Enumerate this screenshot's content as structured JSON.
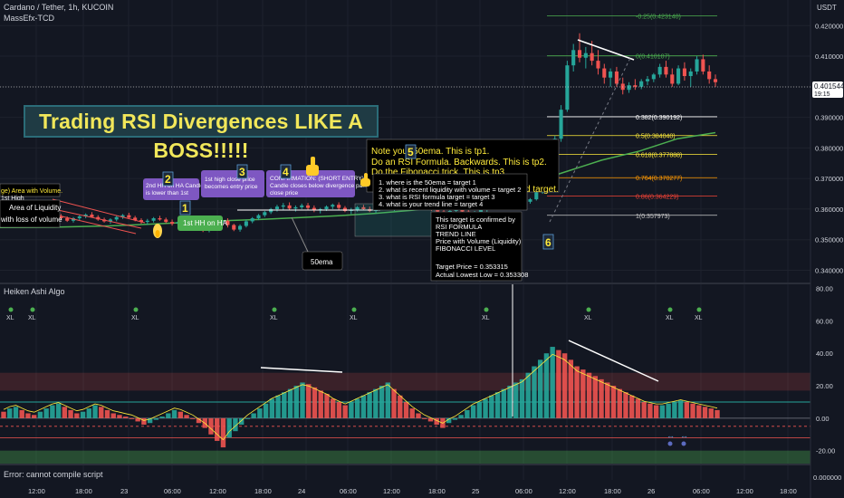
{
  "header": {
    "symbol_line": "Cardano / Tether, 1h, KUCOIN",
    "indicator_line": "MassEfx-TCD"
  },
  "banner": "Trading RSI Divergences LIKE A BOSS!!!!!",
  "lower_pane": {
    "title": "Heiken Ashi Algo",
    "error": "Error: cannot compile script",
    "xl_marks": [
      "XL",
      "XL",
      "XL",
      "XL",
      "XL",
      "XL",
      "XL",
      "XL",
      "XL"
    ],
    "arrow_marks": [
      "↔",
      "↔"
    ]
  },
  "price_axis": {
    "label": "USDT",
    "ticks": [
      "0.420000",
      "0.410000",
      "0.400000",
      "0.390000",
      "0.380000",
      "0.370000",
      "0.360000",
      "0.350000",
      "0.340000"
    ],
    "current_price": "0.401544",
    "countdown": "19:15"
  },
  "osc_axis": {
    "ticks": [
      "80.00",
      "60.00",
      "40.00",
      "20.00",
      "0.00",
      "-20.00"
    ],
    "bottom_tick": "0.000000"
  },
  "time_axis": [
    "12:00",
    "18:00",
    "23",
    "06:00",
    "12:00",
    "18:00",
    "24",
    "06:00",
    "12:00",
    "18:00",
    "25",
    "06:00",
    "12:00",
    "18:00",
    "26",
    "06:00",
    "12:00",
    "18:00"
  ],
  "fib_levels": [
    {
      "label": "-0.25(0.423140)",
      "color": "#4caf50"
    },
    {
      "label": "0(0.410107)",
      "color": "#4caf50"
    },
    {
      "label": "0.382(0.390192)",
      "color": "#ffffff"
    },
    {
      "label": "0.5(0.384040)",
      "color": "#ffeb3b"
    },
    {
      "label": "0.618(0.377888)",
      "color": "#ffeb3b"
    },
    {
      "label": "0.764(0.370277)",
      "color": "#ff9800"
    },
    {
      "label": "0.86(0.364229)",
      "color": "#f44336"
    },
    {
      "label": "1(0.357973)",
      "color": "#cccccc"
    }
  ],
  "step_labels": [
    "1",
    "2",
    "3",
    "4",
    "5",
    "6"
  ],
  "annotations": {
    "left_1": "ge) Area with Volume.",
    "left_1b": "1st High",
    "left_2": "Area of Liquidity",
    "left_3": "with loss of volume",
    "hh_label": "1st HH on HA",
    "note_2": [
      "2nd HH on HA Candle",
      "is lower than 1st"
    ],
    "note_3": [
      "1st high close price",
      "becomes entry price"
    ],
    "note_4": [
      "CONFIRMATION: (SHORT ENTRY)",
      "Candle closes below divergence pa...",
      "close price"
    ],
    "ema_label": "50ema",
    "yellow_note": [
      "Note your 50ema. This is tp1.",
      "Do an RSI Formula. Backwards. This is tp2.",
      "Do the Fibonacci trick. This is tp3",
      "",
      "d target."
    ],
    "target_list": [
      "1. where is the 50ema  = target 1",
      "2. what is recent liquidity with volume = target 2",
      "3. what is RSI formula target = target 3",
      "4. what is your trend line = target 4"
    ],
    "confirm_box": [
      "This target is confirmed by",
      "RSI FORMULA",
      "TREND LINE",
      "Price with Volume (Liquidity)",
      "FIBONACCI LEVEL",
      "",
      "Target Price = 0.353315",
      "Actual Lowest Low = 0.353308"
    ]
  },
  "colors": {
    "bg": "#131722",
    "bull": "#26a69a",
    "bear": "#ef5350",
    "ema": "#4caf50",
    "banner_text": "#f1e75a",
    "accent_purple": "#7e57c2"
  },
  "chart_data": {
    "type": "candlestick",
    "symbol": "Cardano / Tether, 1h, KUCOIN",
    "ylim": [
      0.336,
      0.426
    ],
    "ohlc": [
      [
        0.3575,
        0.3582,
        0.3565,
        0.357
      ],
      [
        0.357,
        0.3578,
        0.356,
        0.3574
      ],
      [
        0.3574,
        0.3585,
        0.3568,
        0.358
      ],
      [
        0.358,
        0.3586,
        0.357,
        0.3572
      ],
      [
        0.3572,
        0.3579,
        0.3562,
        0.3566
      ],
      [
        0.3566,
        0.3576,
        0.356,
        0.3572
      ],
      [
        0.3572,
        0.3584,
        0.3568,
        0.358
      ],
      [
        0.358,
        0.359,
        0.3574,
        0.3586
      ],
      [
        0.3586,
        0.3592,
        0.3576,
        0.3578
      ],
      [
        0.3578,
        0.3584,
        0.3566,
        0.357
      ],
      [
        0.357,
        0.3576,
        0.3558,
        0.3562
      ],
      [
        0.3562,
        0.3574,
        0.3556,
        0.357
      ],
      [
        0.357,
        0.358,
        0.3564,
        0.3576
      ],
      [
        0.3576,
        0.3586,
        0.357,
        0.3582
      ],
      [
        0.3582,
        0.359,
        0.3572,
        0.3574
      ],
      [
        0.3574,
        0.358,
        0.3562,
        0.3566
      ],
      [
        0.3566,
        0.3572,
        0.3556,
        0.356
      ],
      [
        0.356,
        0.357,
        0.3552,
        0.3566
      ],
      [
        0.3566,
        0.3578,
        0.356,
        0.3574
      ],
      [
        0.3574,
        0.3584,
        0.3568,
        0.358
      ],
      [
        0.358,
        0.3588,
        0.357,
        0.3572
      ],
      [
        0.3572,
        0.3578,
        0.356,
        0.3564
      ],
      [
        0.3564,
        0.357,
        0.3552,
        0.3558
      ],
      [
        0.3558,
        0.3568,
        0.3548,
        0.3562
      ],
      [
        0.3562,
        0.3574,
        0.3556,
        0.357
      ],
      [
        0.357,
        0.3578,
        0.3562,
        0.3566
      ],
      [
        0.3566,
        0.3572,
        0.3554,
        0.3558
      ],
      [
        0.3558,
        0.3566,
        0.3546,
        0.3552
      ],
      [
        0.3552,
        0.3562,
        0.3544,
        0.3558
      ],
      [
        0.3558,
        0.3568,
        0.355,
        0.3564
      ],
      [
        0.3564,
        0.357,
        0.3552,
        0.3556
      ],
      [
        0.3556,
        0.3562,
        0.354,
        0.3545
      ],
      [
        0.3545,
        0.355,
        0.3525,
        0.353
      ],
      [
        0.353,
        0.3548,
        0.3524,
        0.3544
      ],
      [
        0.3544,
        0.356,
        0.3538,
        0.3556
      ],
      [
        0.3556,
        0.3566,
        0.3548,
        0.3562
      ],
      [
        0.3562,
        0.357,
        0.354,
        0.3548
      ],
      [
        0.3548,
        0.3552,
        0.3528,
        0.3533
      ],
      [
        0.3533,
        0.355,
        0.3526,
        0.3545
      ],
      [
        0.3545,
        0.3566,
        0.354,
        0.356
      ],
      [
        0.356,
        0.3574,
        0.3554,
        0.357
      ],
      [
        0.357,
        0.3584,
        0.3564,
        0.358
      ],
      [
        0.358,
        0.3594,
        0.3574,
        0.359
      ],
      [
        0.359,
        0.3604,
        0.3584,
        0.36
      ],
      [
        0.36,
        0.3614,
        0.3592,
        0.3608
      ],
      [
        0.3608,
        0.362,
        0.3598,
        0.3612
      ],
      [
        0.3612,
        0.3622,
        0.3596,
        0.3602
      ],
      [
        0.3602,
        0.3612,
        0.3592,
        0.3606
      ],
      [
        0.3606,
        0.3618,
        0.36,
        0.3612
      ],
      [
        0.3612,
        0.362,
        0.3598,
        0.3604
      ],
      [
        0.3604,
        0.3612,
        0.359,
        0.3596
      ],
      [
        0.3596,
        0.3604,
        0.3586,
        0.36
      ],
      [
        0.36,
        0.3612,
        0.3594,
        0.3608
      ],
      [
        0.3608,
        0.3618,
        0.36,
        0.3614
      ],
      [
        0.3614,
        0.3622,
        0.3598,
        0.3604
      ],
      [
        0.3604,
        0.361,
        0.359,
        0.3594
      ],
      [
        0.3594,
        0.3604,
        0.3584,
        0.3598
      ],
      [
        0.3598,
        0.361,
        0.3592,
        0.3606
      ],
      [
        0.3606,
        0.3614,
        0.3596,
        0.36
      ],
      [
        0.36,
        0.3608,
        0.359,
        0.3594
      ],
      [
        0.3594,
        0.3606,
        0.3588,
        0.3602
      ],
      [
        0.3602,
        0.3612,
        0.3596,
        0.3608
      ],
      [
        0.3608,
        0.3616,
        0.3598,
        0.3602
      ],
      [
        0.3602,
        0.361,
        0.3594,
        0.3606
      ],
      [
        0.3606,
        0.3618,
        0.36,
        0.3614
      ],
      [
        0.3614,
        0.3624,
        0.3606,
        0.3618
      ],
      [
        0.3618,
        0.3628,
        0.361,
        0.3622
      ],
      [
        0.3622,
        0.363,
        0.3608,
        0.3612
      ],
      [
        0.3612,
        0.3618,
        0.36,
        0.3606
      ],
      [
        0.3606,
        0.3612,
        0.3594,
        0.36
      ],
      [
        0.36,
        0.3608,
        0.3586,
        0.3592
      ],
      [
        0.3592,
        0.36,
        0.358,
        0.3588
      ],
      [
        0.3588,
        0.3598,
        0.3578,
        0.3594
      ],
      [
        0.3594,
        0.3604,
        0.3586,
        0.3598
      ],
      [
        0.3598,
        0.3606,
        0.3588,
        0.3592
      ],
      [
        0.3592,
        0.3598,
        0.358,
        0.3586
      ],
      [
        0.3586,
        0.3594,
        0.3576,
        0.359
      ],
      [
        0.359,
        0.3602,
        0.3584,
        0.3598
      ],
      [
        0.3598,
        0.361,
        0.359,
        0.3606
      ],
      [
        0.3606,
        0.3618,
        0.3598,
        0.3614
      ],
      [
        0.3614,
        0.3626,
        0.3606,
        0.3622
      ],
      [
        0.3622,
        0.3634,
        0.3614,
        0.363
      ],
      [
        0.363,
        0.364,
        0.362,
        0.3626
      ],
      [
        0.3626,
        0.3632,
        0.3614,
        0.3618
      ],
      [
        0.3618,
        0.3628,
        0.361,
        0.3624
      ],
      [
        0.3624,
        0.3636,
        0.3618,
        0.3632
      ],
      [
        0.3632,
        0.366,
        0.3628,
        0.3655
      ],
      [
        0.3655,
        0.37,
        0.365,
        0.3695
      ],
      [
        0.3695,
        0.374,
        0.369,
        0.373
      ],
      [
        0.373,
        0.384,
        0.3725,
        0.383
      ],
      [
        0.383,
        0.394,
        0.382,
        0.3925
      ],
      [
        0.3925,
        0.4085,
        0.3918,
        0.407
      ],
      [
        0.407,
        0.414,
        0.405,
        0.412
      ],
      [
        0.412,
        0.4175,
        0.408,
        0.4095
      ],
      [
        0.4095,
        0.413,
        0.406,
        0.411
      ],
      [
        0.411,
        0.415,
        0.407,
        0.4085
      ],
      [
        0.4085,
        0.412,
        0.404,
        0.406
      ],
      [
        0.406,
        0.4075,
        0.401,
        0.403
      ],
      [
        0.403,
        0.406,
        0.4,
        0.405
      ],
      [
        0.405,
        0.4065,
        0.4,
        0.401
      ],
      [
        0.401,
        0.403,
        0.3975,
        0.399
      ],
      [
        0.399,
        0.4015,
        0.398,
        0.4005
      ],
      [
        0.4005,
        0.4025,
        0.399,
        0.4
      ],
      [
        0.4,
        0.4025,
        0.3992,
        0.4018
      ],
      [
        0.4018,
        0.4035,
        0.4005,
        0.4025
      ],
      [
        0.4025,
        0.4045,
        0.4015,
        0.404
      ],
      [
        0.404,
        0.4075,
        0.403,
        0.4065
      ],
      [
        0.4065,
        0.4085,
        0.403,
        0.404
      ],
      [
        0.404,
        0.406,
        0.4,
        0.401
      ],
      [
        0.401,
        0.407,
        0.4005,
        0.406
      ],
      [
        0.406,
        0.408,
        0.402,
        0.4035
      ],
      [
        0.4035,
        0.406,
        0.4,
        0.405
      ],
      [
        0.405,
        0.41,
        0.404,
        0.409
      ],
      [
        0.409,
        0.4105,
        0.404,
        0.405
      ],
      [
        0.405,
        0.407,
        0.401,
        0.4025
      ],
      [
        0.4025,
        0.404,
        0.4,
        0.4015
      ]
    ],
    "ema50": [
      0.3545,
      0.355,
      0.3556,
      0.3562,
      0.3566,
      0.3572,
      0.3578,
      0.3586,
      0.3596,
      0.3612,
      0.364,
      0.368,
      0.372,
      0.376,
      0.379,
      0.383,
      0.385
    ],
    "osc_ylim": [
      -28,
      82
    ],
    "osc_hist": [
      4,
      6,
      7,
      5,
      3,
      2,
      4,
      6,
      8,
      9,
      7,
      5,
      3,
      4,
      6,
      8,
      7,
      5,
      3,
      2,
      1,
      0,
      -2,
      -4,
      -3,
      -1,
      1,
      3,
      5,
      4,
      2,
      0,
      -3,
      -6,
      -10,
      -14,
      -18,
      -12,
      -8,
      -4,
      0,
      3,
      6,
      9,
      12,
      14,
      16,
      18,
      20,
      22,
      21,
      19,
      17,
      15,
      12,
      10,
      8,
      10,
      12,
      14,
      16,
      18,
      20,
      22,
      18,
      14,
      10,
      6,
      3,
      0,
      -2,
      -4,
      -6,
      -3,
      -1,
      2,
      5,
      8,
      10,
      12,
      14,
      16,
      18,
      20,
      22,
      24,
      28,
      32,
      36,
      40,
      44,
      42,
      40,
      36,
      32,
      30,
      28,
      26,
      24,
      22,
      20,
      18,
      16,
      14,
      12,
      10,
      9,
      8,
      8,
      9,
      10,
      11,
      10,
      9,
      8,
      7,
      6,
      5
    ],
    "osc_bands": {
      "upper": [
        17,
        28
      ],
      "mid_line": 10,
      "zero_line": 0,
      "lower": [
        -20,
        -28
      ],
      "dashed": -5
    }
  }
}
